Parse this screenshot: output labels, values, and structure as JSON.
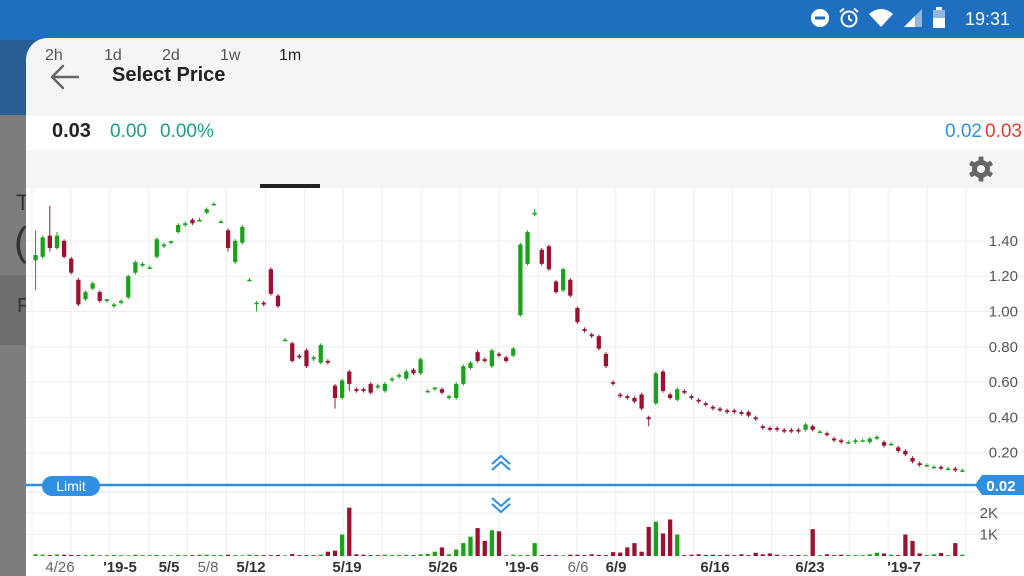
{
  "status_bar": {
    "time": "19:31",
    "icons": [
      "do-not-disturb-icon",
      "alarm-icon",
      "wifi-icon",
      "signal-icon",
      "battery-icon"
    ]
  },
  "background": {
    "text_1": "T",
    "text_2": "(",
    "text_3": "F"
  },
  "sheet": {
    "title": "Select Price",
    "back_icon": "arrow-left-icon"
  },
  "quote": {
    "last": "0.03",
    "change": "0.00",
    "change_pct": "0.00%",
    "bid": "0.02",
    "ask": "0.03"
  },
  "tabs": [
    {
      "label": "2h"
    },
    {
      "label": "1d"
    },
    {
      "label": "2d"
    },
    {
      "label": "1w"
    },
    {
      "label": "1m"
    }
  ],
  "active_tab": "1m",
  "settings_icon": "gear-icon",
  "limit": {
    "label": "Limit",
    "value": "0.02"
  },
  "colors": {
    "status_bar": "#1e6fc0",
    "up": "#1aa31a",
    "down": "#9a1230",
    "limit_line": "#2f8fe0",
    "change": "#1f9c8a",
    "bid": "#2f8fe0",
    "ask": "#e03a2f"
  },
  "chart_data": {
    "type": "candlestick",
    "price_ticks": [
      "1.40",
      "1.20",
      "1.00",
      "0.80",
      "0.60",
      "0.40",
      "0.20"
    ],
    "price_tick_values": [
      1.4,
      1.2,
      1.0,
      0.8,
      0.6,
      0.4,
      0.2
    ],
    "volume_ticks": [
      "2K",
      "1K"
    ],
    "volume_tick_values": [
      2000,
      1000
    ],
    "x_labels": [
      "4/26",
      "'19-5",
      "5/5",
      "5/8",
      "5/12",
      "5/19",
      "5/26",
      "'19-6",
      "6/6",
      "6/9",
      "6/16",
      "6/23",
      "'19-7"
    ],
    "x_label_bold": [
      false,
      true,
      true,
      false,
      true,
      true,
      true,
      true,
      false,
      true,
      true,
      true,
      true
    ],
    "series": [
      [
        1.29,
        1.32,
        1.46,
        1.12
      ],
      [
        1.31,
        1.42,
        1.43,
        1.3
      ],
      [
        1.43,
        1.36,
        1.6,
        1.34
      ],
      [
        1.36,
        1.43,
        1.45,
        1.35
      ],
      [
        1.4,
        1.31,
        1.41,
        1.3
      ],
      [
        1.3,
        1.22,
        1.31,
        1.21
      ],
      [
        1.18,
        1.04,
        1.19,
        1.03
      ],
      [
        1.07,
        1.11,
        1.12,
        1.06
      ],
      [
        1.13,
        1.16,
        1.17,
        1.12
      ],
      [
        1.11,
        1.06,
        1.12,
        1.05
      ],
      [
        1.06,
        1.07,
        1.07,
        1.05
      ],
      [
        1.03,
        1.04,
        1.05,
        1.02
      ],
      [
        1.05,
        1.06,
        1.07,
        1.04
      ],
      [
        1.08,
        1.2,
        1.21,
        1.07
      ],
      [
        1.22,
        1.28,
        1.29,
        1.21
      ],
      [
        1.26,
        1.27,
        1.28,
        1.25
      ],
      [
        1.25,
        1.25,
        1.26,
        1.24
      ],
      [
        1.31,
        1.41,
        1.42,
        1.3
      ],
      [
        1.37,
        1.38,
        1.39,
        1.36
      ],
      [
        1.39,
        1.4,
        1.4,
        1.38
      ],
      [
        1.45,
        1.49,
        1.5,
        1.44
      ],
      [
        1.49,
        1.5,
        1.51,
        1.48
      ],
      [
        1.52,
        1.5,
        1.53,
        1.49
      ],
      [
        1.51,
        1.52,
        1.53,
        1.51
      ],
      [
        1.56,
        1.58,
        1.59,
        1.55
      ],
      [
        1.61,
        1.61,
        1.62,
        1.6
      ],
      [
        1.51,
        1.51,
        1.52,
        1.5
      ],
      [
        1.46,
        1.36,
        1.47,
        1.34
      ],
      [
        1.28,
        1.4,
        1.41,
        1.27
      ],
      [
        1.39,
        1.48,
        1.49,
        1.38
      ],
      [
        1.18,
        1.18,
        1.19,
        1.17
      ],
      [
        1.05,
        1.05,
        1.06,
        1.0
      ],
      [
        1.05,
        1.04,
        1.06,
        1.03
      ],
      [
        1.24,
        1.1,
        1.25,
        1.09
      ],
      [
        1.09,
        1.03,
        1.1,
        1.02
      ],
      [
        0.84,
        0.84,
        0.85,
        0.83
      ],
      [
        0.82,
        0.72,
        0.83,
        0.71
      ],
      [
        0.75,
        0.74,
        0.76,
        0.73
      ],
      [
        0.78,
        0.69,
        0.79,
        0.68
      ],
      [
        0.73,
        0.74,
        0.75,
        0.72
      ],
      [
        0.71,
        0.81,
        0.82,
        0.7
      ],
      [
        0.72,
        0.71,
        0.73,
        0.7
      ],
      [
        0.58,
        0.51,
        0.59,
        0.45
      ],
      [
        0.51,
        0.61,
        0.62,
        0.5
      ],
      [
        0.66,
        0.59,
        0.67,
        0.55
      ],
      [
        0.56,
        0.55,
        0.57,
        0.54
      ],
      [
        0.56,
        0.55,
        0.57,
        0.54
      ],
      [
        0.59,
        0.54,
        0.6,
        0.53
      ],
      [
        0.57,
        0.58,
        0.59,
        0.56
      ],
      [
        0.55,
        0.59,
        0.6,
        0.54
      ],
      [
        0.61,
        0.62,
        0.63,
        0.6
      ],
      [
        0.63,
        0.64,
        0.65,
        0.62
      ],
      [
        0.62,
        0.66,
        0.67,
        0.61
      ],
      [
        0.67,
        0.65,
        0.68,
        0.64
      ],
      [
        0.65,
        0.73,
        0.74,
        0.64
      ],
      [
        0.55,
        0.55,
        0.56,
        0.54
      ],
      [
        0.56,
        0.57,
        0.57,
        0.55
      ],
      [
        0.56,
        0.54,
        0.57,
        0.53
      ],
      [
        0.51,
        0.52,
        0.53,
        0.5
      ],
      [
        0.51,
        0.59,
        0.6,
        0.5
      ],
      [
        0.59,
        0.69,
        0.7,
        0.58
      ],
      [
        0.68,
        0.71,
        0.72,
        0.67
      ],
      [
        0.77,
        0.72,
        0.78,
        0.71
      ],
      [
        0.73,
        0.72,
        0.74,
        0.71
      ],
      [
        0.69,
        0.78,
        0.79,
        0.68
      ],
      [
        0.76,
        0.75,
        0.77,
        0.74
      ],
      [
        0.74,
        0.72,
        0.75,
        0.71
      ],
      [
        0.75,
        0.79,
        0.8,
        0.74
      ],
      [
        0.98,
        1.38,
        1.39,
        0.97
      ],
      [
        1.27,
        1.45,
        1.46,
        1.26
      ],
      [
        1.55,
        1.56,
        1.58,
        1.54
      ],
      [
        1.35,
        1.27,
        1.36,
        1.26
      ],
      [
        1.37,
        1.24,
        1.38,
        1.23
      ],
      [
        1.17,
        1.11,
        1.18,
        1.1
      ],
      [
        1.12,
        1.24,
        1.25,
        1.11
      ],
      [
        1.18,
        1.09,
        1.19,
        1.08
      ],
      [
        1.02,
        0.94,
        1.03,
        0.93
      ],
      [
        0.9,
        0.89,
        0.91,
        0.88
      ],
      [
        0.87,
        0.86,
        0.88,
        0.85
      ],
      [
        0.86,
        0.79,
        0.87,
        0.78
      ],
      [
        0.76,
        0.69,
        0.77,
        0.68
      ],
      [
        0.6,
        0.59,
        0.61,
        0.58
      ],
      [
        0.53,
        0.52,
        0.54,
        0.51
      ],
      [
        0.52,
        0.51,
        0.53,
        0.5
      ],
      [
        0.51,
        0.49,
        0.52,
        0.48
      ],
      [
        0.53,
        0.45,
        0.54,
        0.44
      ],
      [
        0.4,
        0.39,
        0.41,
        0.35
      ],
      [
        0.48,
        0.65,
        0.66,
        0.47
      ],
      [
        0.66,
        0.55,
        0.67,
        0.54
      ],
      [
        0.53,
        0.51,
        0.54,
        0.5
      ],
      [
        0.5,
        0.56,
        0.57,
        0.49
      ],
      [
        0.55,
        0.54,
        0.56,
        0.53
      ],
      [
        0.52,
        0.51,
        0.53,
        0.5
      ],
      [
        0.5,
        0.49,
        0.51,
        0.48
      ],
      [
        0.48,
        0.47,
        0.49,
        0.46
      ],
      [
        0.46,
        0.45,
        0.47,
        0.44
      ],
      [
        0.45,
        0.44,
        0.46,
        0.43
      ],
      [
        0.44,
        0.43,
        0.45,
        0.42
      ],
      [
        0.44,
        0.43,
        0.45,
        0.42
      ],
      [
        0.43,
        0.42,
        0.44,
        0.41
      ],
      [
        0.43,
        0.41,
        0.44,
        0.4
      ],
      [
        0.4,
        0.39,
        0.41,
        0.38
      ],
      [
        0.35,
        0.34,
        0.36,
        0.33
      ],
      [
        0.34,
        0.33,
        0.35,
        0.32
      ],
      [
        0.34,
        0.33,
        0.35,
        0.32
      ],
      [
        0.33,
        0.32,
        0.34,
        0.31
      ],
      [
        0.33,
        0.32,
        0.34,
        0.31
      ],
      [
        0.33,
        0.32,
        0.34,
        0.31
      ],
      [
        0.33,
        0.36,
        0.37,
        0.32
      ],
      [
        0.35,
        0.33,
        0.36,
        0.32
      ],
      [
        0.32,
        0.32,
        0.33,
        0.31
      ],
      [
        0.31,
        0.3,
        0.32,
        0.29
      ],
      [
        0.28,
        0.27,
        0.29,
        0.26
      ],
      [
        0.27,
        0.26,
        0.28,
        0.25
      ],
      [
        0.26,
        0.26,
        0.27,
        0.25
      ],
      [
        0.26,
        0.27,
        0.28,
        0.25
      ],
      [
        0.27,
        0.27,
        0.28,
        0.26
      ],
      [
        0.26,
        0.28,
        0.29,
        0.25
      ],
      [
        0.28,
        0.29,
        0.3,
        0.27
      ],
      [
        0.26,
        0.24,
        0.27,
        0.23
      ],
      [
        0.25,
        0.25,
        0.26,
        0.24
      ],
      [
        0.23,
        0.21,
        0.24,
        0.2
      ],
      [
        0.21,
        0.19,
        0.22,
        0.18
      ],
      [
        0.17,
        0.15,
        0.18,
        0.14
      ],
      [
        0.14,
        0.13,
        0.15,
        0.12
      ],
      [
        0.13,
        0.13,
        0.14,
        0.12
      ],
      [
        0.12,
        0.12,
        0.13,
        0.11
      ],
      [
        0.12,
        0.11,
        0.13,
        0.1
      ],
      [
        0.11,
        0.11,
        0.12,
        0.1
      ],
      [
        0.11,
        0.1,
        0.12,
        0.09
      ],
      [
        0.1,
        0.1,
        0.11,
        0.09
      ]
    ],
    "volume": [
      80,
      60,
      40,
      70,
      60,
      50,
      40,
      40,
      60,
      30,
      40,
      50,
      40,
      30,
      60,
      40,
      40,
      50,
      40,
      30,
      50,
      40,
      40,
      60,
      60,
      40,
      40,
      60,
      40,
      30,
      60,
      50,
      40,
      40,
      50,
      30,
      90,
      40,
      40,
      50,
      60,
      200,
      250,
      1000,
      2250,
      80,
      60,
      40,
      50,
      60,
      40,
      50,
      60,
      40,
      80,
      100,
      200,
      400,
      80,
      300,
      600,
      900,
      1300,
      700,
      1200,
      1150,
      30,
      60,
      40,
      50,
      600,
      40,
      50,
      40,
      30,
      60,
      60,
      40,
      80,
      50,
      40,
      180,
      160,
      400,
      600,
      200,
      1350,
      1600,
      1050,
      1700,
      1000,
      40,
      60,
      80,
      50,
      60,
      40,
      60,
      40,
      80,
      40,
      150,
      80,
      120,
      60,
      30,
      40,
      50,
      40,
      1250,
      40,
      80,
      40,
      60,
      50,
      40,
      40,
      80,
      150,
      120,
      60,
      40,
      1000,
      700,
      120,
      40,
      80,
      140,
      40,
      600,
      60,
      300,
      280,
      40,
      30,
      40,
      1020
    ],
    "price_range": [
      0.0,
      1.7
    ],
    "volume_range": [
      0,
      2700
    ],
    "grid": true,
    "limit_price": 0.02
  }
}
